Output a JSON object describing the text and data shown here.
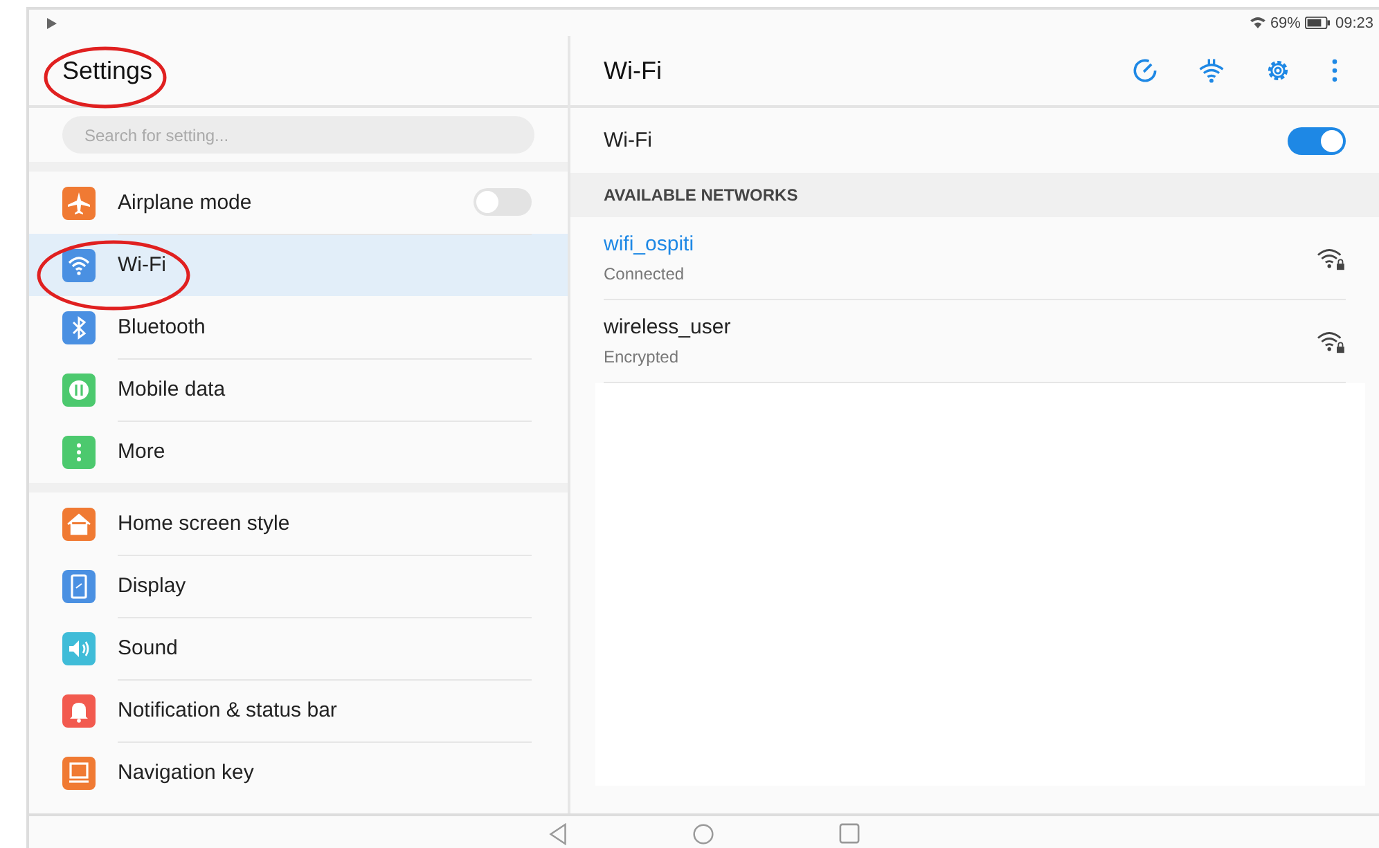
{
  "status_bar": {
    "battery": "69%",
    "time": "09:23"
  },
  "sidebar": {
    "title": "Settings",
    "search": {
      "placeholder": "Search for setting..."
    },
    "groups": [
      {
        "items": [
          {
            "label": "Airplane mode",
            "color": "#f07a33",
            "selected": false,
            "kind": "toggle",
            "on": false
          },
          {
            "label": "Wi-Fi",
            "color": "#4a90e2",
            "selected": true,
            "kind": "link"
          },
          {
            "label": "Bluetooth",
            "color": "#4a90e2",
            "selected": false,
            "kind": "link"
          },
          {
            "label": "Mobile data",
            "color": "#4cc96e",
            "selected": false,
            "kind": "link"
          },
          {
            "label": "More",
            "color": "#4cc96e",
            "selected": false,
            "kind": "link"
          }
        ]
      },
      {
        "items": [
          {
            "label": "Home screen style",
            "color": "#f07a33",
            "selected": false,
            "kind": "link"
          },
          {
            "label": "Display",
            "color": "#4a90e2",
            "selected": false,
            "kind": "link"
          },
          {
            "label": "Sound",
            "color": "#3fbcd8",
            "selected": false,
            "kind": "link"
          },
          {
            "label": "Notification & status bar",
            "color": "#f25a4f",
            "selected": false,
            "kind": "link"
          },
          {
            "label": "Navigation key",
            "color": "#f07a33",
            "selected": false,
            "kind": "link"
          }
        ]
      }
    ]
  },
  "detail": {
    "title": "Wi-Fi",
    "wifi_switch": {
      "label": "Wi-Fi",
      "on": true
    },
    "section_header": "AVAILABLE NETWORKS",
    "networks": [
      {
        "name": "wifi_ospiti",
        "status": "Connected",
        "connected": true
      },
      {
        "name": "wireless_user",
        "status": "Encrypted",
        "connected": false
      }
    ]
  }
}
